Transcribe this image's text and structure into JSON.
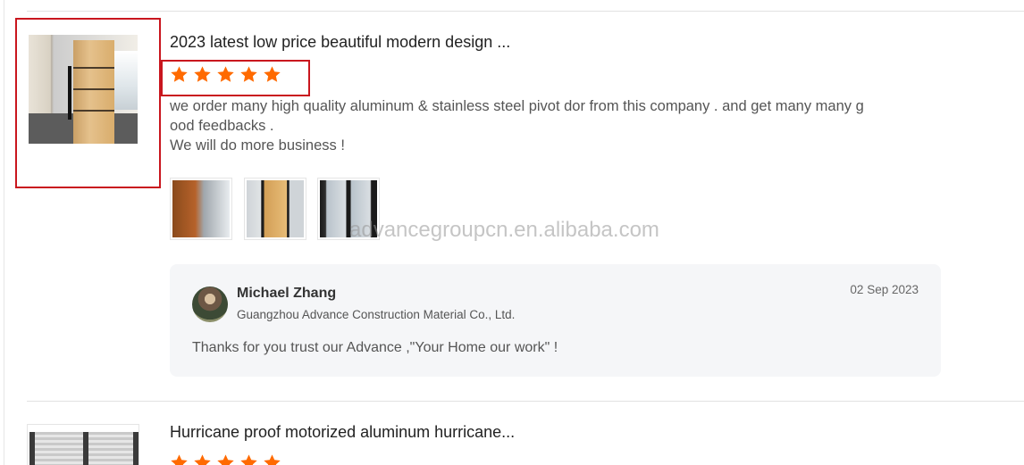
{
  "reviews": [
    {
      "product_title": "2023 latest low price beautiful modern design ...",
      "rating": 5,
      "rating_max": 5,
      "review_lines": [
        "we order many high quality aluminum & stainless steel pivot dor from this company . and get many many g",
        "ood feedbacks .",
        "We will do more business !"
      ],
      "photos_count": 3,
      "reply": {
        "seller_name": "Michael Zhang",
        "company": "Guangzhou Advance Construction Material Co., Ltd.",
        "date": "02 Sep 2023",
        "text": "Thanks for you trust our Advance ,\"Your Home our work\" !"
      }
    },
    {
      "product_title": "Hurricane proof motorized aluminum hurricane...",
      "rating": 5,
      "rating_max": 5
    }
  ],
  "watermark": "advancegroupcn.en.alibaba.com",
  "colors": {
    "star": "#ff6a00",
    "highlight": "#c9161e",
    "reply_bg": "#f5f6f8"
  }
}
